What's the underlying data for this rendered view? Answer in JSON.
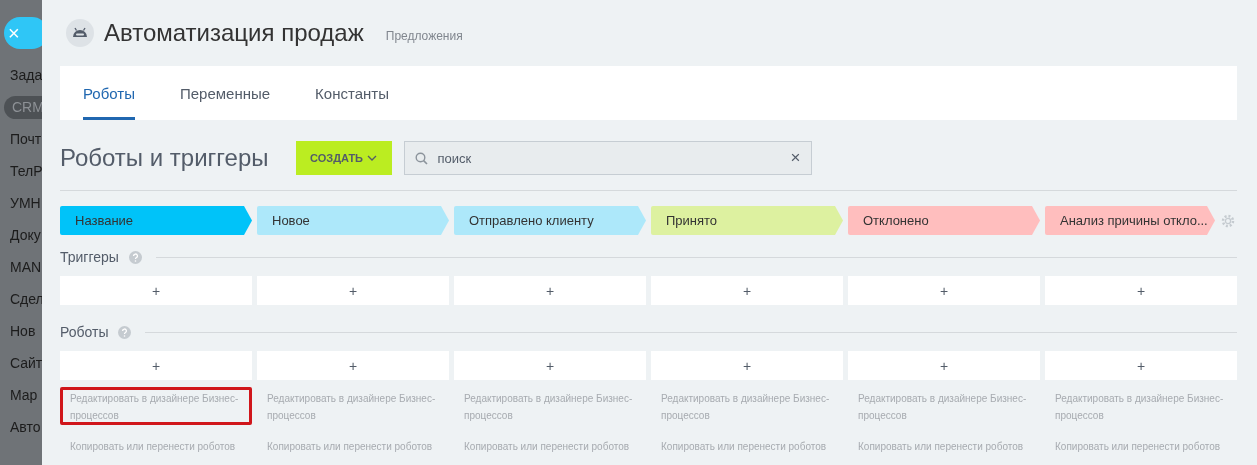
{
  "sidebar": {
    "close_button": "×",
    "items": [
      {
        "label": "Зада",
        "selected": false
      },
      {
        "label": "CRM",
        "selected": true
      },
      {
        "label": "Почт",
        "selected": false
      },
      {
        "label": "ТелР",
        "selected": false
      },
      {
        "label": "УМН",
        "selected": false
      },
      {
        "label": "Доку",
        "selected": false
      },
      {
        "label": "MAN",
        "selected": false
      },
      {
        "label": "Сдел",
        "selected": false
      },
      {
        "label": "Нов",
        "selected": false
      },
      {
        "label": "Сайт",
        "selected": false
      },
      {
        "label": "Мар",
        "selected": false
      },
      {
        "label": "Авто",
        "selected": false
      }
    ]
  },
  "header": {
    "title": "Автоматизация продаж",
    "subtitle": "Предложения"
  },
  "tabs": [
    {
      "label": "Роботы",
      "selected": true
    },
    {
      "label": "Переменные",
      "selected": false
    },
    {
      "label": "Константы",
      "selected": false
    }
  ],
  "toolbar": {
    "title": "Роботы и триггеры",
    "create_button": "СОЗДАТЬ",
    "search": {
      "placeholder": "поиск",
      "clear": "×"
    }
  },
  "stages": [
    {
      "name": "Название",
      "color": "#00c3f9"
    },
    {
      "name": "Новое",
      "color": "#ade8fa"
    },
    {
      "name": "Отправлено клиенту",
      "color": "#ade8fa"
    },
    {
      "name": "Принято",
      "color": "#ddf1a0"
    },
    {
      "name": "Отклонено",
      "color": "#ffbebe"
    },
    {
      "name": "Анализ причины откло...",
      "color": "#ffbebe"
    }
  ],
  "triggers": {
    "title": "Триггеры",
    "cells": [
      "+",
      "+",
      "+",
      "+",
      "+",
      "+"
    ]
  },
  "robots": {
    "title": "Роботы",
    "columns": [
      {
        "add": "+",
        "edit_link": "Редактировать в дизайнере Бизнес-процессов",
        "copy_link": "Копировать или перенести роботов",
        "highlighted": true
      },
      {
        "add": "+",
        "edit_link": "Редактировать в дизайнере Бизнес-процессов",
        "copy_link": "Копировать или перенести роботов",
        "highlighted": false
      },
      {
        "add": "+",
        "edit_link": "Редактировать в дизайнере Бизнес-процессов",
        "copy_link": "Копировать или перенести роботов",
        "highlighted": false
      },
      {
        "add": "+",
        "edit_link": "Редактировать в дизайнере Бизнес-процессов",
        "copy_link": "Копировать или перенести роботов",
        "highlighted": false
      },
      {
        "add": "+",
        "edit_link": "Редактировать в дизайнере Бизнес-процессов",
        "copy_link": "Копировать или перенести роботов",
        "highlighted": false
      },
      {
        "add": "+",
        "edit_link": "Редактировать в дизайнере Бизнес-процессов",
        "copy_link": "Копировать или перенести роботов",
        "highlighted": false
      }
    ]
  }
}
